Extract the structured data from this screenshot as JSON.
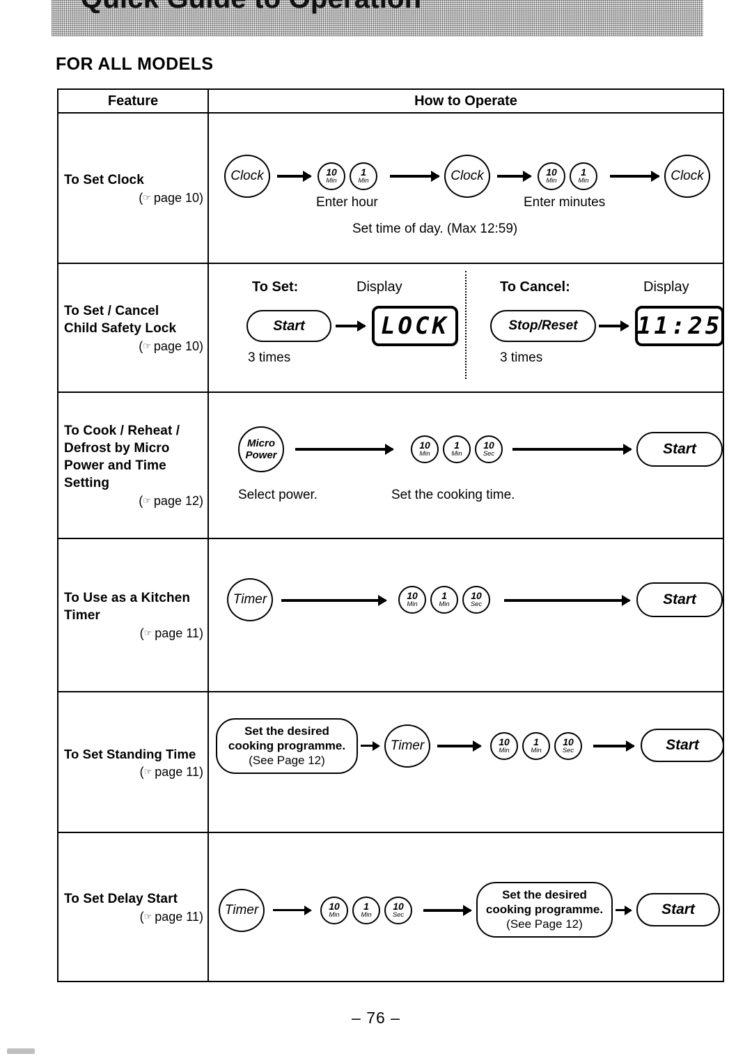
{
  "banner": {
    "title": "Quick Guide to Operation"
  },
  "section_heading": "FOR ALL MODELS",
  "table": {
    "headers": {
      "feature": "Feature",
      "how_to_operate": "How to Operate"
    },
    "rows": [
      {
        "feature_line1": "To Set Clock",
        "feature_line2": "",
        "feature_line3": "",
        "feature_line4": "",
        "page_ref": "page 10",
        "hand_icon": "pointing-hand-icon",
        "nodes": {
          "clock1": "Clock",
          "clock2": "Clock",
          "clock3": "Clock",
          "key_10min_num": "10",
          "key_10min_unit": "Min",
          "key_1min_num": "1",
          "key_1min_unit": "Min",
          "key2_10min_num": "10",
          "key2_10min_unit": "Min",
          "key2_1min_num": "1",
          "key2_1min_unit": "Min"
        },
        "captions": {
          "enter_hour": "Enter hour",
          "enter_minutes": "Enter minutes",
          "set_time": "Set time of day. (Max 12:59)"
        }
      },
      {
        "feature_line1": "To Set / Cancel",
        "feature_line2": "Child Safety Lock",
        "page_ref": "page 10",
        "hand_icon": "pointing-hand-icon",
        "to_set_label": "To Set:",
        "to_cancel_label": "To Cancel:",
        "display_label_left": "Display",
        "display_label_right": "Display",
        "start_button": "Start",
        "stop_reset_button": "Stop/Reset",
        "times_left": "3 times",
        "times_right": "3 times",
        "lcd_left": "LOCK",
        "lcd_right": "11:25"
      },
      {
        "feature_line1": "To Cook / Reheat /",
        "feature_line2": "Defrost by Micro",
        "feature_line3": "Power and Time",
        "feature_line4": "Setting",
        "page_ref": "page 12",
        "hand_icon": "pointing-hand-icon",
        "micro_power_l1": "Micro",
        "micro_power_l2": "Power",
        "key_10min_num": "10",
        "key_10min_unit": "Min",
        "key_1min_num": "1",
        "key_1min_unit": "Min",
        "key_10sec_num": "10",
        "key_10sec_unit": "Sec",
        "start_button": "Start",
        "caption_select": "Select power.",
        "caption_time": "Set the cooking time."
      },
      {
        "feature_line1": "To Use as a Kitchen",
        "feature_line2": "Timer",
        "page_ref": "page 11",
        "hand_icon": "pointing-hand-icon",
        "timer_button": "Timer",
        "key_10min_num": "10",
        "key_10min_unit": "Min",
        "key_1min_num": "1",
        "key_1min_unit": "Min",
        "key_10sec_num": "10",
        "key_10sec_unit": "Sec",
        "start_button": "Start"
      },
      {
        "feature_line1": "To Set Standing Time",
        "page_ref": "page 11",
        "hand_icon": "pointing-hand-icon",
        "prog_l1": "Set the desired",
        "prog_l2": "cooking programme.",
        "prog_l3": "(See Page 12)",
        "timer_button": "Timer",
        "key_10min_num": "10",
        "key_10min_unit": "Min",
        "key_1min_num": "1",
        "key_1min_unit": "Min",
        "key_10sec_num": "10",
        "key_10sec_unit": "Sec",
        "start_button": "Start"
      },
      {
        "feature_line1": "To Set Delay Start",
        "page_ref": "page 11",
        "hand_icon": "pointing-hand-icon",
        "timer_button": "Timer",
        "key_10min_num": "10",
        "key_10min_unit": "Min",
        "key_1min_num": "1",
        "key_1min_unit": "Min",
        "key_10sec_num": "10",
        "key_10sec_unit": "Sec",
        "prog_l1": "Set the desired",
        "prog_l2": "cooking programme.",
        "prog_l3": "(See Page 12)",
        "start_button": "Start"
      }
    ]
  },
  "footer": {
    "page_number": "– 76 –"
  }
}
